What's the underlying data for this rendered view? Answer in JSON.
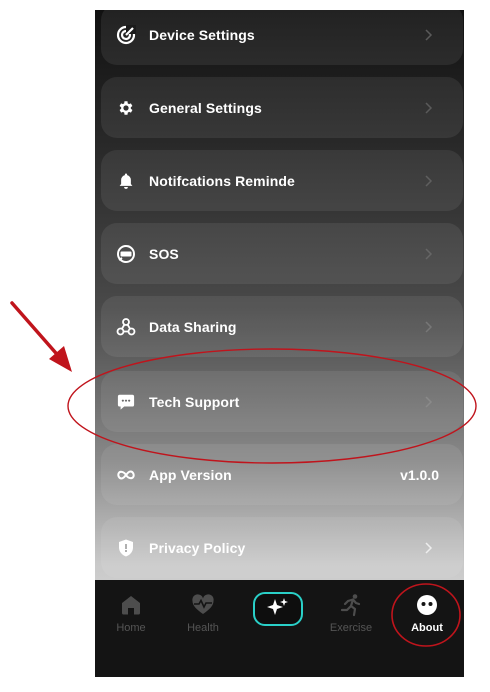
{
  "menu": {
    "items": [
      {
        "label": "Device Settings",
        "icon": "target-icon"
      },
      {
        "label": "General Settings",
        "icon": "gear-icon"
      },
      {
        "label": "Notifcations Reminde",
        "icon": "bell-icon"
      },
      {
        "label": "SOS",
        "icon": "sos-icon"
      },
      {
        "label": "Data Sharing",
        "icon": "share-nodes-icon"
      },
      {
        "label": "Tech Support",
        "icon": "chat-bubble-icon"
      },
      {
        "label": "App Version",
        "icon": "infinity-icon",
        "value": "v1.0.0"
      },
      {
        "label": "Privacy Policy",
        "icon": "shield-icon"
      }
    ]
  },
  "tabbar": {
    "home": "Home",
    "health": "Health",
    "exercise": "Exercise",
    "about": "About",
    "active": "About"
  },
  "colors": {
    "accent_border": "#2ad0c8",
    "annotation": "#c0141c"
  }
}
